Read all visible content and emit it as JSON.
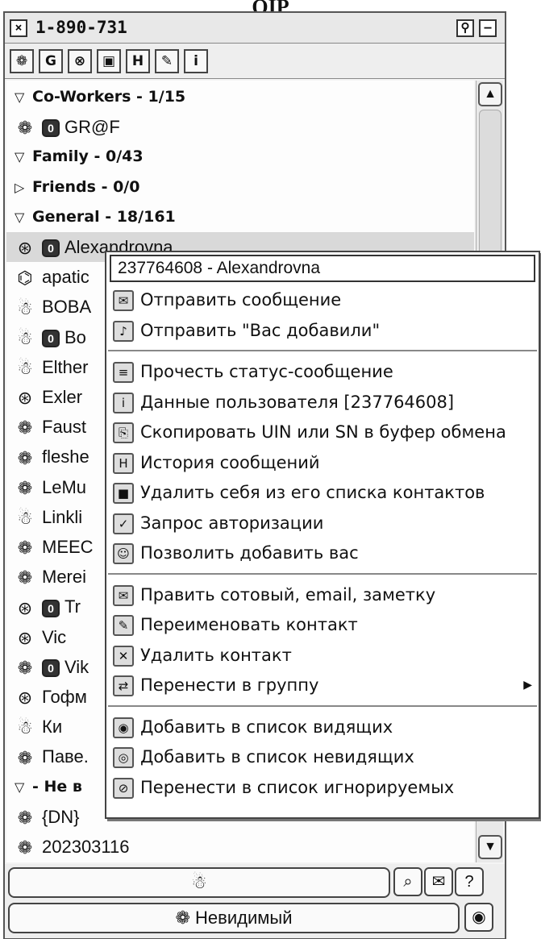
{
  "caption": "QIP",
  "window": {
    "title": "1-890-731",
    "close_glyph": "×",
    "pin_glyph": "⚲",
    "min_glyph": "–"
  },
  "toolbar": {
    "tools": [
      {
        "name": "status-flower-icon",
        "glyph": "❁"
      },
      {
        "name": "g-icon",
        "glyph": "G"
      },
      {
        "name": "x-icon",
        "glyph": "⊗"
      },
      {
        "name": "card-icon",
        "glyph": "▣"
      },
      {
        "name": "history-icon",
        "glyph": "H"
      },
      {
        "name": "tools-icon",
        "glyph": "✎"
      },
      {
        "name": "info-icon",
        "glyph": "i"
      }
    ]
  },
  "contacts": {
    "groups_and_items": [
      {
        "kind": "group",
        "arrow": "▽",
        "label": "Co-Workers - 1/15"
      },
      {
        "kind": "contact",
        "icon": "❁",
        "badge": "0",
        "label": "GR@F"
      },
      {
        "kind": "group",
        "arrow": "▽",
        "label": "Family - 0/43"
      },
      {
        "kind": "group",
        "arrow": "▷",
        "label": "Friends - 0/0"
      },
      {
        "kind": "group",
        "arrow": "▽",
        "label": "General - 18/161"
      },
      {
        "kind": "contact",
        "icon": "⊛",
        "badge": "0",
        "label": "Alexandrovna",
        "selected": true
      },
      {
        "kind": "contact",
        "icon": "⌬",
        "label": "apatic"
      },
      {
        "kind": "contact",
        "icon": "☃",
        "label": "BOBA"
      },
      {
        "kind": "contact",
        "icon": "☃",
        "badge": "0",
        "label": "Bo"
      },
      {
        "kind": "contact",
        "icon": "☃",
        "label": "Elther"
      },
      {
        "kind": "contact",
        "icon": "⊛",
        "label": "Exler"
      },
      {
        "kind": "contact",
        "icon": "❁",
        "label": "Faust"
      },
      {
        "kind": "contact",
        "icon": "❁",
        "label": "fleshe"
      },
      {
        "kind": "contact",
        "icon": "❁",
        "label": "LeMu"
      },
      {
        "kind": "contact",
        "icon": "☃",
        "label": "Linkli"
      },
      {
        "kind": "contact",
        "icon": "❁",
        "label": "MEEC"
      },
      {
        "kind": "contact",
        "icon": "❁",
        "label": "Merei"
      },
      {
        "kind": "contact",
        "icon": "⊛",
        "badge": "0",
        "label": "Tr"
      },
      {
        "kind": "contact",
        "icon": "⊛",
        "label": "Vic"
      },
      {
        "kind": "contact",
        "icon": "❁",
        "badge": "0",
        "label": "Vik"
      },
      {
        "kind": "contact",
        "icon": "⊛",
        "label": "Гофм"
      },
      {
        "kind": "contact",
        "icon": "☃",
        "label": "Ки"
      },
      {
        "kind": "contact",
        "icon": "❁",
        "label": "Паве."
      },
      {
        "kind": "group",
        "arrow": "▽",
        "label": "- Не в"
      },
      {
        "kind": "contact",
        "icon": "❁",
        "label": "{DN}"
      },
      {
        "kind": "contact",
        "icon": "❁",
        "label": "202303116"
      }
    ]
  },
  "scrollbar": {
    "up": "▲",
    "down": "▼"
  },
  "bottom": {
    "main_icon": "☃",
    "btn1_icon": "⌕",
    "btn2_icon": "✉",
    "btn3_icon": "?",
    "status_icon": "❁",
    "status_label": "Невидимый",
    "eye_icon": "◉"
  },
  "context_menu": {
    "header": "237764608 - Alexandrovna",
    "items": [
      {
        "name": "menu-send-message",
        "icon": "✉",
        "label": "Отправить сообщение"
      },
      {
        "name": "menu-send-added",
        "icon": "♪",
        "label": "Отправить \"Вас добавили\""
      },
      {
        "sep": true
      },
      {
        "name": "menu-read-status",
        "icon": "≡",
        "label": "Прочесть статус-сообщение"
      },
      {
        "name": "menu-user-info",
        "icon": "i",
        "label": "Данные пользователя  [237764608]"
      },
      {
        "name": "menu-copy-uin",
        "icon": "⎘",
        "label": "Скопировать UIN или SN в буфер обмена"
      },
      {
        "name": "menu-history",
        "icon": "H",
        "label": "История сообщений"
      },
      {
        "name": "menu-remove-self",
        "icon": "■",
        "label": "Удалить себя из его списка контактов"
      },
      {
        "name": "menu-auth-request",
        "icon": "✓",
        "label": "Запрос авторизации"
      },
      {
        "name": "menu-allow-add",
        "icon": "☺",
        "label": "Позволить добавить вас"
      },
      {
        "sep": true
      },
      {
        "name": "menu-edit-contact",
        "icon": "✉",
        "label": "Править сотовый, email, заметку"
      },
      {
        "name": "menu-rename",
        "icon": "✎",
        "label": "Переименовать контакт"
      },
      {
        "name": "menu-delete",
        "icon": "✕",
        "label": "Удалить контакт"
      },
      {
        "name": "menu-move-group",
        "icon": "⇄",
        "label": "Перенести в группу",
        "submenu": "▶"
      },
      {
        "sep": true
      },
      {
        "name": "menu-add-visible",
        "icon": "◉",
        "label": "Добавить в список видящих"
      },
      {
        "name": "menu-add-invisible",
        "icon": "◎",
        "label": "Добавить в список невидящих"
      },
      {
        "name": "menu-add-ignore",
        "icon": "⊘",
        "label": "Перенести в список игнорируемых"
      }
    ]
  }
}
